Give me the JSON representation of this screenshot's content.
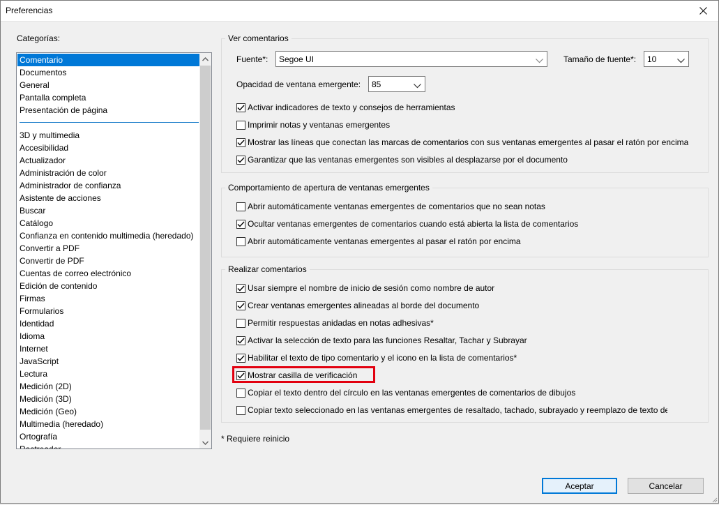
{
  "window": {
    "title": "Preferencias"
  },
  "categories": {
    "label": "Categorías:",
    "items_top": [
      "Comentario",
      "Documentos",
      "General",
      "Pantalla completa",
      "Presentación de página"
    ],
    "items_bottom": [
      "3D y multimedia",
      "Accesibilidad",
      "Actualizador",
      "Administración de color",
      "Administrador de confianza",
      "Asistente de acciones",
      "Buscar",
      "Catálogo",
      "Confianza en contenido multimedia (heredado)",
      "Convertir a PDF",
      "Convertir de PDF",
      "Cuentas de correo electrónico",
      "Edición de contenido",
      "Firmas",
      "Formularios",
      "Identidad",
      "Idioma",
      "Internet",
      "JavaScript",
      "Lectura",
      "Medición (2D)",
      "Medición (3D)",
      "Medición (Geo)",
      "Multimedia (heredado)",
      "Ortografía",
      "Rastreador"
    ],
    "selected": "Comentario"
  },
  "view_comments": {
    "legend": "Ver comentarios",
    "font_label": "Fuente*:",
    "font_value": "Segoe UI",
    "size_label": "Tamaño de fuente*:",
    "size_value": "10",
    "opacity_label": "Opacidad de ventana emergente:",
    "opacity_value": "85",
    "checks": [
      {
        "label": "Activar indicadores de texto y consejos de herramientas",
        "checked": true
      },
      {
        "label": "Imprimir notas y ventanas emergentes",
        "checked": false
      },
      {
        "label": "Mostrar las líneas que conectan las marcas de comentarios con sus ventanas emergentes al pasar el ratón por encima",
        "checked": true
      },
      {
        "label": "Garantizar que las ventanas emergentes son visibles al desplazarse por el documento",
        "checked": true
      }
    ]
  },
  "popup_behavior": {
    "legend": "Comportamiento de apertura de ventanas emergentes",
    "checks": [
      {
        "label": "Abrir automáticamente ventanas emergentes de comentarios que no sean notas",
        "checked": false
      },
      {
        "label": "Ocultar ventanas emergentes de comentarios cuando está abierta la lista de comentarios",
        "checked": true
      },
      {
        "label": "Abrir automáticamente ventanas emergentes al pasar el ratón por encima",
        "checked": false
      }
    ]
  },
  "make_comments": {
    "legend": "Realizar comentarios",
    "checks": [
      {
        "label": "Usar siempre el nombre de inicio de sesión como nombre de autor",
        "checked": true
      },
      {
        "label": "Crear ventanas emergentes alineadas al borde del documento",
        "checked": true
      },
      {
        "label": "Permitir respuestas anidadas en notas adhesivas*",
        "checked": false
      },
      {
        "label": "Activar la selección de texto para las funciones Resaltar, Tachar y Subrayar",
        "checked": true
      },
      {
        "label": "Habilitar el texto de tipo comentario y el icono en la lista de comentarios*",
        "checked": true
      },
      {
        "label": "Mostrar casilla de verificación",
        "checked": true
      },
      {
        "label": "Copiar el texto dentro del círculo en las ventanas emergentes de comentarios de dibujos",
        "checked": false
      },
      {
        "label": "Copiar texto seleccionado en las ventanas emergentes de resaltado, tachado, subrayado y reemplazo de texto de cc",
        "checked": false
      }
    ]
  },
  "footer": {
    "note": "* Requiere reinicio",
    "ok_label": "Aceptar",
    "cancel_label": "Cancelar"
  },
  "colors": {
    "selection": "#0078d7",
    "highlight": "#e2000f"
  }
}
